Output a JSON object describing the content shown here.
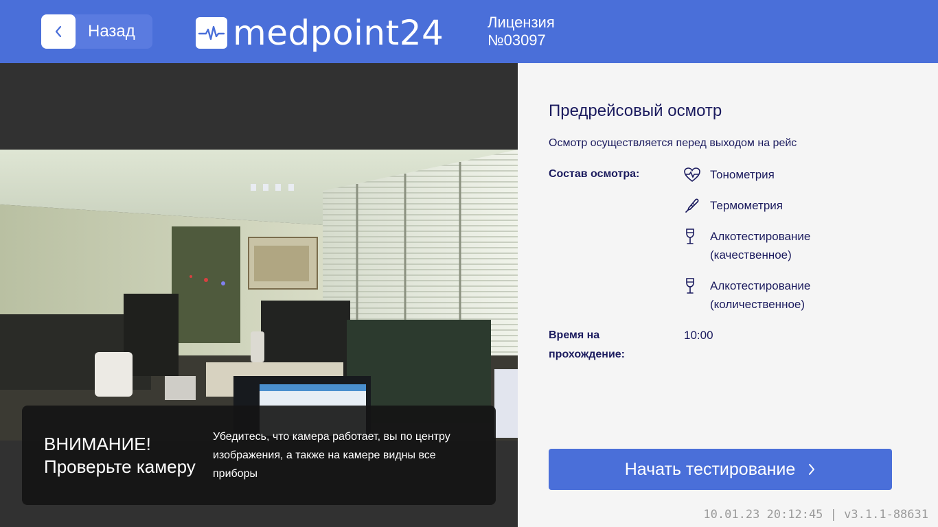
{
  "header": {
    "back_label": "Назад",
    "logo_text": "medpoint24",
    "license_line1": "Лицензия",
    "license_line2": "№03097",
    "accent": "#4a6fd9"
  },
  "camera": {
    "warning_title_line1": "ВНИМАНИЕ!",
    "warning_title_line2": "Проверьте камеру",
    "warning_text": "Убедитесь, что камера работает, вы по центру изображения, а также на камере видны все приборы"
  },
  "info": {
    "title": "Предрейсовый осмотр",
    "subtitle": "Осмотр осуществляется перед выходом на рейс",
    "composition_label": "Состав осмотра:",
    "items": [
      {
        "icon": "heart-pulse-icon",
        "line1": "Тонометрия",
        "line2": ""
      },
      {
        "icon": "thermometer-icon",
        "line1": "Термометрия",
        "line2": ""
      },
      {
        "icon": "wine-glass-icon",
        "line1": "Алкотестирование",
        "line2": "(качественное)"
      },
      {
        "icon": "wine-glass-icon",
        "line1": "Алкотестирование",
        "line2": "(количественное)"
      }
    ],
    "time_label_line1": "Время на",
    "time_label_line2": "прохождение:",
    "time_value": "10:00",
    "start_button": "Начать тестирование"
  },
  "footer": {
    "datetime": "10.01.23 20:12:45",
    "separator": "|",
    "version": "v3.1.1-88631"
  }
}
